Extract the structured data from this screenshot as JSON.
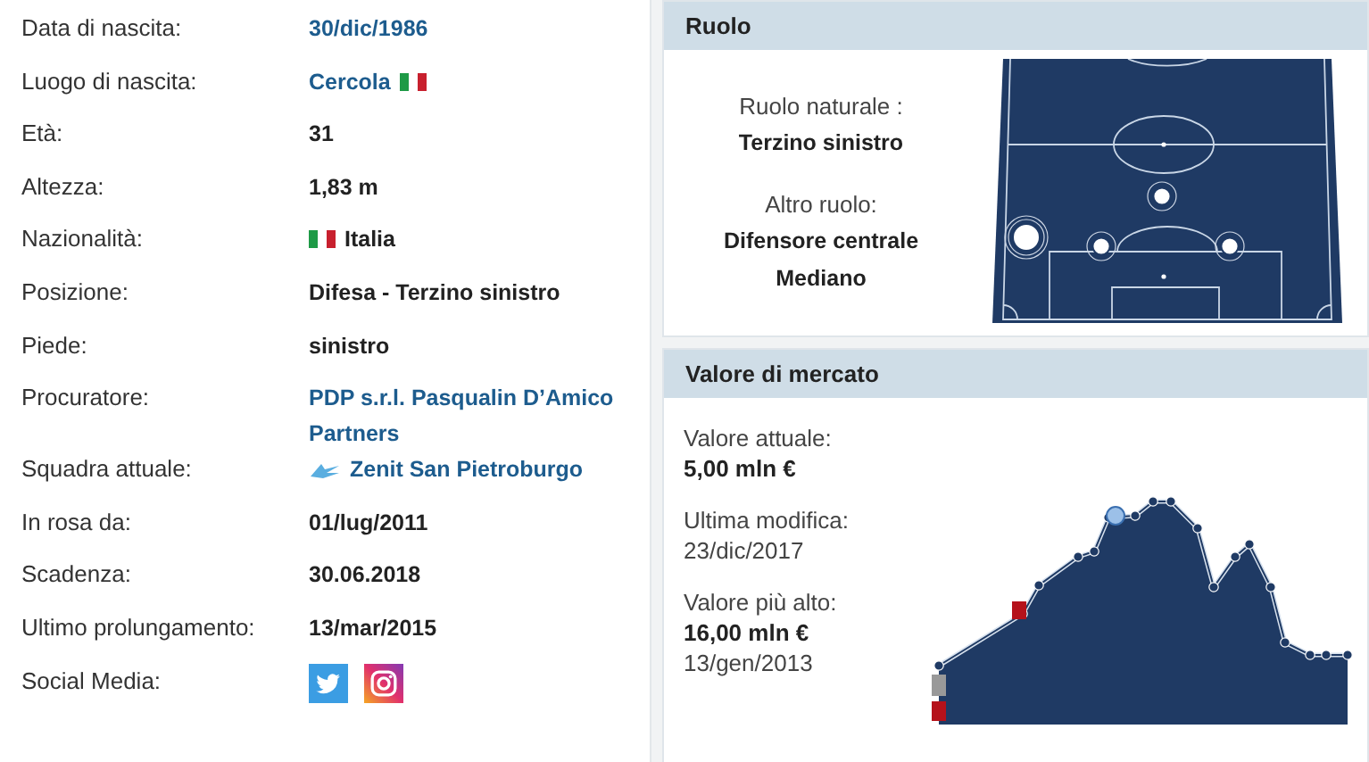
{
  "profile_rows": [
    {
      "label": "Data di nascita:",
      "kind": "link",
      "value": "30/dic/1986"
    },
    {
      "label": "Luogo di nascita:",
      "kind": "link-flag",
      "value": "Cercola"
    },
    {
      "label": "Età:",
      "kind": "text",
      "value": "31"
    },
    {
      "label": "Altezza:",
      "kind": "text",
      "value": "1,83 m"
    },
    {
      "label": "Nazionalità:",
      "kind": "flag-text",
      "value": "Italia"
    },
    {
      "label": "Posizione:",
      "kind": "text",
      "value": "Difesa - Terzino sinistro"
    },
    {
      "label": "Piede:",
      "kind": "text",
      "value": "sinistro"
    },
    {
      "label": "Procuratore:",
      "kind": "link",
      "value": "PDP s.r.l. Pasqualin D’Amico Partners"
    },
    {
      "label": "Squadra attuale:",
      "kind": "club-link",
      "value": "Zenit San Pietroburgo"
    },
    {
      "label": "In rosa da:",
      "kind": "text",
      "value": "01/lug/2011"
    },
    {
      "label": "Scadenza:",
      "kind": "text",
      "value": "30.06.2018"
    },
    {
      "label": "Ultimo prolungamento:",
      "kind": "text",
      "value": "13/mar/2015"
    },
    {
      "label": "Social Media:",
      "kind": "social"
    }
  ],
  "role": {
    "title": "Ruolo",
    "natural_label": "Ruolo naturale :",
    "natural_role": "Terzino sinistro",
    "other_label": "Altro ruolo:",
    "other_roles": [
      "Difensore centrale",
      "Mediano"
    ]
  },
  "market_value": {
    "title": "Valore di mercato",
    "current_label": "Valore attuale:",
    "current_value": "5,00 mln €",
    "modified_label": "Ultima modifica:",
    "modified_date": "23/dic/2017",
    "highest_label": "Valore più alto:",
    "highest_value": "16,00 mln €",
    "highest_date": "13/gen/2013"
  }
}
